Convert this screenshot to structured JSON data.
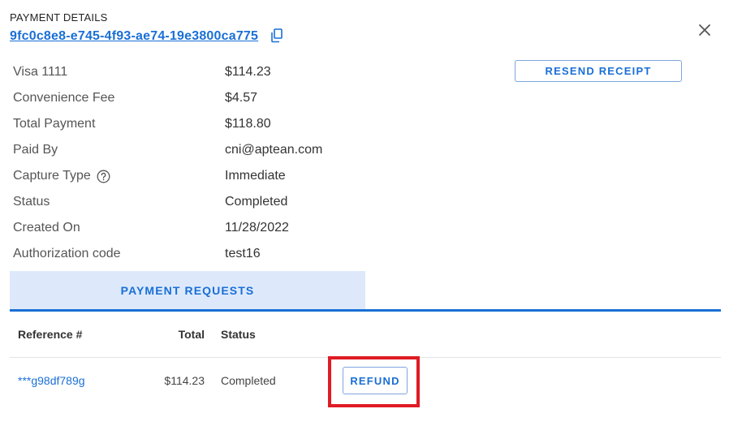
{
  "header": {
    "title": "PAYMENT DETAILS",
    "payment_id": "9fc0c8e8-e745-4f93-ae74-19e3800ca775"
  },
  "actions": {
    "resend_receipt": "RESEND RECEIPT"
  },
  "details": [
    {
      "label": "Visa 1111",
      "value": "$114.23"
    },
    {
      "label": "Convenience Fee",
      "value": "$4.57"
    },
    {
      "label": "Total Payment",
      "value": "$118.80"
    },
    {
      "label": "Paid By",
      "value": "cni@aptean.com"
    },
    {
      "label": "Capture Type",
      "value": "Immediate"
    },
    {
      "label": "Status",
      "value": "Completed"
    },
    {
      "label": "Created On",
      "value": "11/28/2022"
    },
    {
      "label": "Authorization code",
      "value": "test16"
    }
  ],
  "tabs": [
    {
      "label": "PAYMENT REQUESTS"
    }
  ],
  "table": {
    "headers": {
      "reference": "Reference #",
      "total": "Total",
      "status": "Status"
    },
    "rows": [
      {
        "reference": "***g98df789g",
        "total": "$114.23",
        "status": "Completed",
        "action": "REFUND"
      }
    ]
  },
  "colors": {
    "accent": "#1a6fd6",
    "tab_background": "#dde9fb",
    "highlight": "#e01b24"
  },
  "icons": {
    "copy": "copy-icon",
    "close": "close-icon",
    "help": "help-circle-icon"
  }
}
